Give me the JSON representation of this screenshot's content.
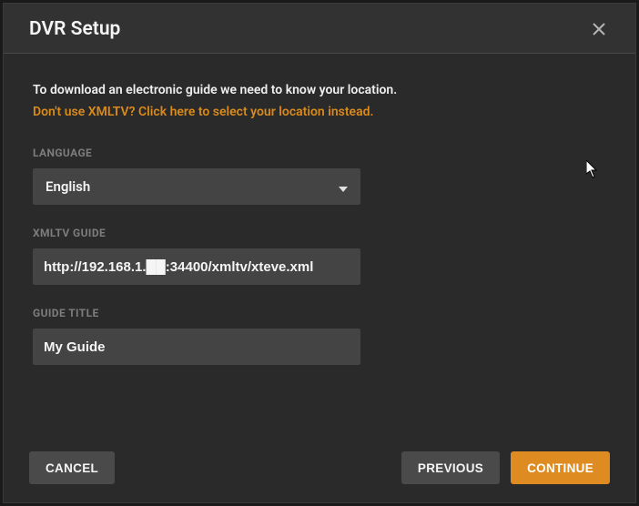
{
  "header": {
    "title": "DVR Setup"
  },
  "body": {
    "intro": "To download an electronic guide we need to know your location.",
    "alt_link": "Don't use XMLTV? Click here to select your location instead.",
    "fields": {
      "language": {
        "label": "LANGUAGE",
        "value": "English"
      },
      "guide_url": {
        "label": "XMLTV GUIDE",
        "value": "http://192.168.1.██:34400/xmltv/xteve.xml"
      },
      "guide_title": {
        "label": "GUIDE TITLE",
        "value": "My Guide"
      }
    }
  },
  "footer": {
    "cancel": "CANCEL",
    "previous": "PREVIOUS",
    "continue": "CONTINUE"
  },
  "colors": {
    "accent": "#de8b22",
    "link": "#d98a1c"
  }
}
